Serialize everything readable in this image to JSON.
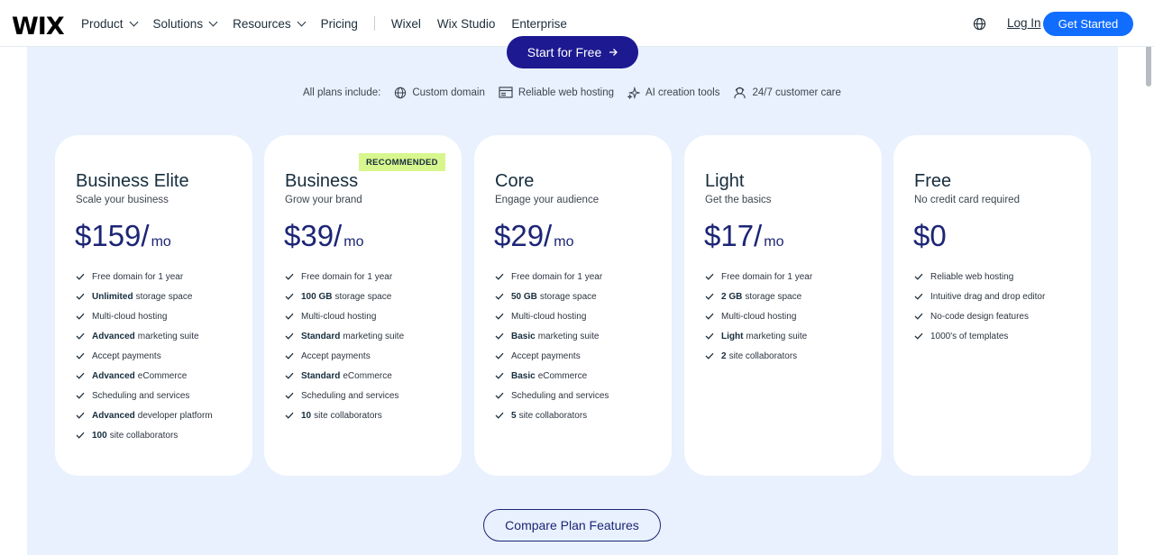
{
  "header": {
    "logo": "WIX",
    "nav": [
      {
        "label": "Product",
        "dropdown": true
      },
      {
        "label": "Solutions",
        "dropdown": true
      },
      {
        "label": "Resources",
        "dropdown": true
      },
      {
        "label": "Pricing",
        "dropdown": false
      }
    ],
    "nav_secondary": [
      "Wixel",
      "Wix Studio",
      "Enterprise"
    ],
    "login": "Log In",
    "get_started": "Get Started"
  },
  "hero": {
    "start_free": "Start for Free",
    "includes_label": "All plans include:",
    "includes": [
      {
        "label": "Custom domain",
        "icon": "globe-icon"
      },
      {
        "label": "Reliable web hosting",
        "icon": "hosting-icon"
      },
      {
        "label": "AI creation tools",
        "icon": "sparkle-icon"
      },
      {
        "label": "24/7 customer care",
        "icon": "headset-icon"
      }
    ]
  },
  "plans": [
    {
      "name": "Business Elite",
      "subtitle": "Scale your business",
      "price": "$159/",
      "period": "mo",
      "badge": "",
      "features": [
        {
          "bold": "",
          "text": "Free domain for 1 year"
        },
        {
          "bold": "Unlimited",
          "text": "storage space"
        },
        {
          "bold": "",
          "text": "Multi-cloud hosting"
        },
        {
          "bold": "Advanced",
          "text": "marketing suite"
        },
        {
          "bold": "",
          "text": "Accept payments"
        },
        {
          "bold": "Advanced",
          "text": "eCommerce"
        },
        {
          "bold": "",
          "text": "Scheduling and services"
        },
        {
          "bold": "Advanced",
          "text": "developer platform"
        },
        {
          "bold": "100",
          "text": "site collaborators"
        }
      ]
    },
    {
      "name": "Business",
      "subtitle": "Grow your brand",
      "price": "$39/",
      "period": "mo",
      "badge": "RECOMMENDED",
      "features": [
        {
          "bold": "",
          "text": "Free domain for 1 year"
        },
        {
          "bold": "100 GB",
          "text": "storage space"
        },
        {
          "bold": "",
          "text": "Multi-cloud hosting"
        },
        {
          "bold": "Standard",
          "text": "marketing suite"
        },
        {
          "bold": "",
          "text": "Accept payments"
        },
        {
          "bold": "Standard",
          "text": "eCommerce"
        },
        {
          "bold": "",
          "text": "Scheduling and services"
        },
        {
          "bold": "10",
          "text": "site collaborators"
        }
      ]
    },
    {
      "name": "Core",
      "subtitle": "Engage your audience",
      "price": "$29/",
      "period": "mo",
      "badge": "",
      "features": [
        {
          "bold": "",
          "text": "Free domain for 1 year"
        },
        {
          "bold": "50 GB",
          "text": "storage space"
        },
        {
          "bold": "",
          "text": "Multi-cloud hosting"
        },
        {
          "bold": "Basic",
          "text": "marketing suite"
        },
        {
          "bold": "",
          "text": "Accept payments"
        },
        {
          "bold": "Basic",
          "text": "eCommerce"
        },
        {
          "bold": "",
          "text": "Scheduling and services"
        },
        {
          "bold": "5",
          "text": "site collaborators"
        }
      ]
    },
    {
      "name": "Light",
      "subtitle": "Get the basics",
      "price": "$17/",
      "period": "mo",
      "badge": "",
      "features": [
        {
          "bold": "",
          "text": "Free domain for 1 year"
        },
        {
          "bold": "2 GB",
          "text": "storage space"
        },
        {
          "bold": "",
          "text": "Multi-cloud hosting"
        },
        {
          "bold": "Light",
          "text": "marketing suite"
        },
        {
          "bold": "2",
          "text": "site collaborators"
        }
      ]
    },
    {
      "name": "Free",
      "subtitle": "No credit card required",
      "price": "$0",
      "period": "",
      "badge": "",
      "features": [
        {
          "bold": "",
          "text": "Reliable web hosting"
        },
        {
          "bold": "",
          "text": "Intuitive drag and drop editor"
        },
        {
          "bold": "",
          "text": "No-code design features"
        },
        {
          "bold": "",
          "text": "1000's of templates"
        }
      ]
    }
  ],
  "compare": "Compare Plan Features",
  "colors": {
    "accent": "#116dff",
    "navy": "#1c1991",
    "panel": "#e8f1fd",
    "badge": "#d8f68e"
  }
}
